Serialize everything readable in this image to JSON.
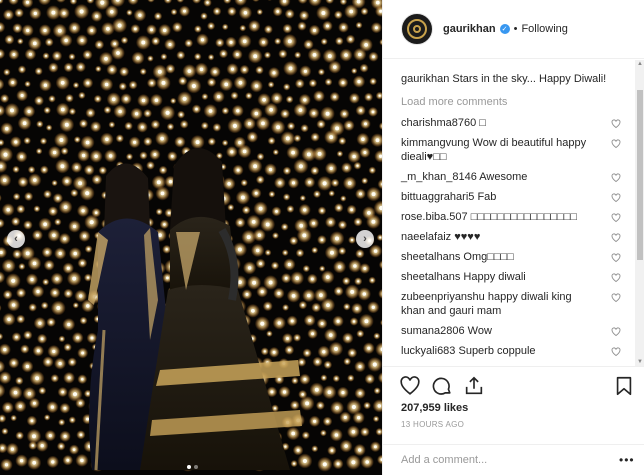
{
  "post": {
    "username": "gaurikhan",
    "follow_status": "Following",
    "separator": "•",
    "caption_user": "gaurikhan",
    "caption_text": "Stars in the sky... Happy Diwali!",
    "load_more": "Load more comments",
    "likes": "207,959 likes",
    "timestamp": "13 HOURS AGO",
    "add_comment_placeholder": "Add a comment...",
    "more_options": "•••",
    "carousel": {
      "slide_count": 2,
      "current_slide": 1
    }
  },
  "comments": [
    {
      "user": "charishma8760",
      "text": "□"
    },
    {
      "user": "kimmangvung",
      "text": "Wow di beautiful happy dieali♥□□"
    },
    {
      "user": "_m_khan_8146",
      "text": "Awesome"
    },
    {
      "user": "bittuaggrahari5",
      "text": "Fab"
    },
    {
      "user": "rose.biba.507",
      "text": "□□□□□□□□□□□□□□□□"
    },
    {
      "user": "naeelafaiz",
      "text": "♥♥♥♥"
    },
    {
      "user": "sheetalhans",
      "text": "Omg□□□□"
    },
    {
      "user": "sheetalhans",
      "text": "Happy diwali"
    },
    {
      "user": "zubeenpriyanshu",
      "text": "happy diwali king khan and gauri mam"
    },
    {
      "user": "sumana2806",
      "text": "Wow"
    },
    {
      "user": "luckyali683",
      "text": "Superb coppule"
    },
    {
      "user": "",
      "text": ""
    }
  ],
  "icons": {
    "like": "heart-icon",
    "comment": "comment-icon",
    "share": "share-icon",
    "save": "bookmark-icon",
    "verified": "verified-badge-icon"
  },
  "colors": {
    "link_blue": "#3897f0",
    "muted": "#999999",
    "text": "#262626",
    "border": "#efefef"
  }
}
